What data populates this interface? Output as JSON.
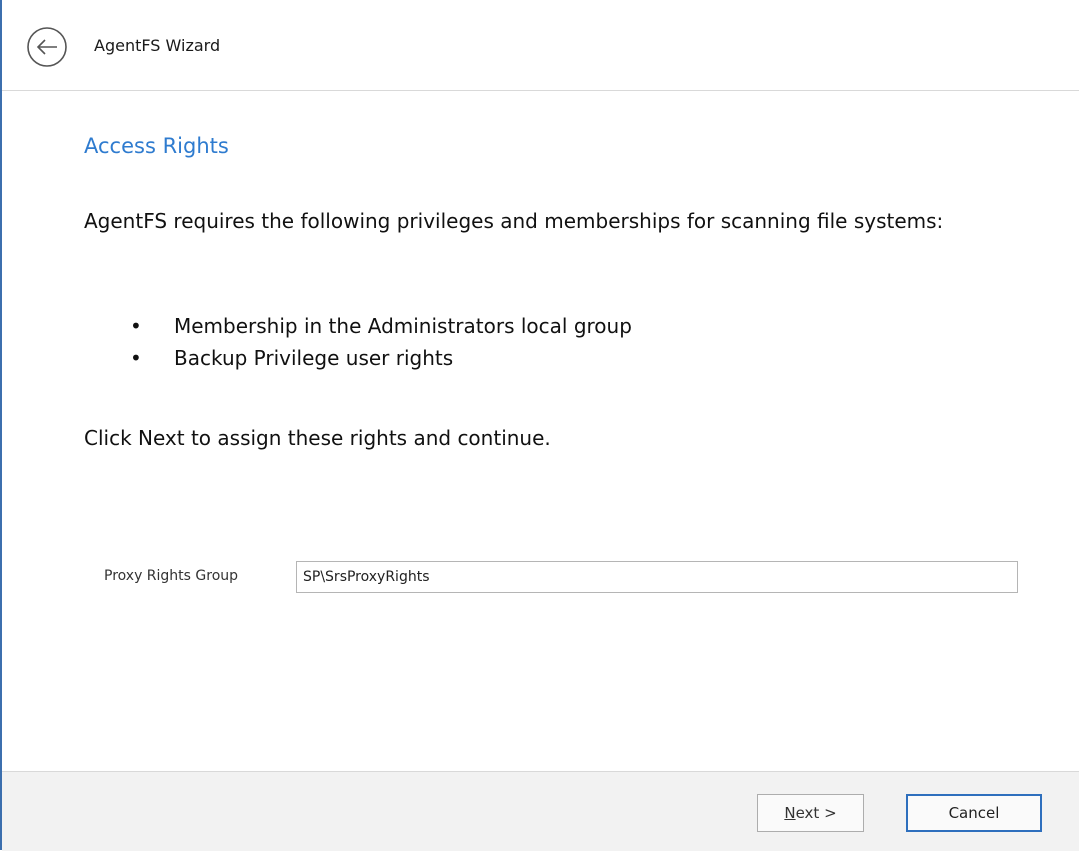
{
  "window": {
    "title": "AgentFS Wizard",
    "back_icon": "back-arrow-circle-icon"
  },
  "page": {
    "title": "Access Rights",
    "intro": "AgentFS requires the following privileges and memberships for scanning file systems:",
    "rights": [
      "Membership in the Administrators local group",
      "Backup Privilege user rights"
    ],
    "bullet": "•",
    "instruction": "Click Next to assign these rights and continue."
  },
  "form": {
    "proxy_rights_group": {
      "label": "Proxy Rights Group",
      "value": "SP\\SrsProxyRights"
    }
  },
  "footer": {
    "next": {
      "mnemonic": "N",
      "rest": "ext >"
    },
    "cancel_label": "Cancel"
  },
  "colors": {
    "accent": "#2e7bcf",
    "window_border": "#3c6fae",
    "footer_background": "#f2f2f2"
  }
}
